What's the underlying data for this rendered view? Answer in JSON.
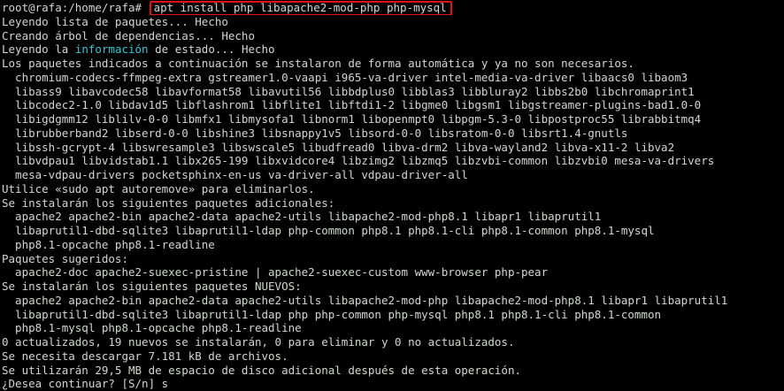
{
  "prompt": "root@rafa:/home/rafa# ",
  "command": "apt install php libapache2-mod-php php-mysql",
  "accent_colors": {
    "command_box": "#e0121c",
    "highlight_text": "#34c6d3"
  },
  "lines": {
    "l2": "Leyendo lista de paquetes... Hecho",
    "l3": "Creando árbol de dependencias... Hecho",
    "l4_pre": "Leyendo la ",
    "l4_hl": "información",
    "l4_post": " de estado... Hecho",
    "l5": "Los paquetes indicados a continuación se instalaron de forma automática y ya no son necesarios.",
    "l6": "  chromium-codecs-ffmpeg-extra gstreamer1.0-vaapi i965-va-driver intel-media-va-driver libaacs0 libaom3",
    "l7": "  libass9 libavcodec58 libavformat58 libavutil56 libbdplus0 libblas3 libbluray2 libbs2b0 libchromaprint1",
    "l8": "  libcodec2-1.0 libdav1d5 libflashrom1 libflite1 libftdi1-2 libgme0 libgsm1 libgstreamer-plugins-bad1.0-0",
    "l9": "  libigdgmm12 liblilv-0-0 libmfx1 libmysofa1 libnorm1 libopenmpt0 libpgm-5.3-0 libpostproc55 librabbitmq4",
    "l10": "  librubberband2 libserd-0-0 libshine3 libsnappy1v5 libsord-0-0 libsratom-0-0 libsrt1.4-gnutls",
    "l11": "  libssh-gcrypt-4 libswresample3 libswscale5 libudfread0 libva-drm2 libva-wayland2 libva-x11-2 libva2",
    "l12": "  libvdpau1 libvidstab1.1 libx265-199 libxvidcore4 libzimg2 libzmq5 libzvbi-common libzvbi0 mesa-va-drivers",
    "l13": "  mesa-vdpau-drivers pocketsphinx-en-us va-driver-all vdpau-driver-all",
    "l14": "Utilice «sudo apt autoremove» para eliminarlos.",
    "l15": "Se instalarán los siguientes paquetes adicionales:",
    "l16": "  apache2 apache2-bin apache2-data apache2-utils libapache2-mod-php8.1 libapr1 libaprutil1",
    "l17": "  libaprutil1-dbd-sqlite3 libaprutil1-ldap php-common php8.1 php8.1-cli php8.1-common php8.1-mysql",
    "l18": "  php8.1-opcache php8.1-readline",
    "l19": "Paquetes sugeridos:",
    "l20": "  apache2-doc apache2-suexec-pristine | apache2-suexec-custom www-browser php-pear",
    "l21": "Se instalarán los siguientes paquetes NUEVOS:",
    "l22": "  apache2 apache2-bin apache2-data apache2-utils libapache2-mod-php libapache2-mod-php8.1 libapr1 libaprutil1",
    "l23": "  libaprutil1-dbd-sqlite3 libaprutil1-ldap php php-common php-mysql php8.1 php8.1-cli php8.1-common",
    "l24": "  php8.1-mysql php8.1-opcache php8.1-readline",
    "l25": "0 actualizados, 19 nuevos se instalarán, 0 para eliminar y 0 no actualizados.",
    "l26": "Se necesita descargar 7.181 kB de archivos.",
    "l27": "Se utilizarán 29,5 MB de espacio de disco adicional después de esta operación.",
    "l28_question": "¿Desea continuar? [S/n] ",
    "l28_answer": "s"
  }
}
